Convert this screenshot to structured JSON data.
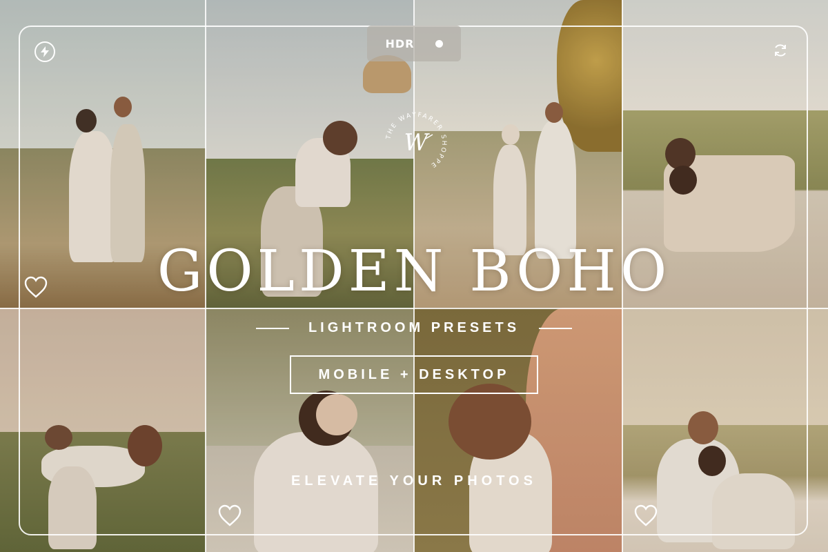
{
  "badge": {
    "label": "HDR"
  },
  "logo": {
    "ring_text": "THE WAYFARER SHOPPE",
    "monogram": "W"
  },
  "title": "GOLDEN BOHO",
  "subtitle": "LIGHTROOM PRESETS",
  "platform": "MOBILE + DESKTOP",
  "tagline": "ELEVATE YOUR PHOTOS",
  "icons": {
    "top_left": "flash-icon",
    "top_right": "refresh-icon",
    "hearts": [
      "heart-icon",
      "heart-icon",
      "heart-icon"
    ]
  },
  "colors": {
    "text": "#ffffff",
    "frame": "#ffffff"
  }
}
